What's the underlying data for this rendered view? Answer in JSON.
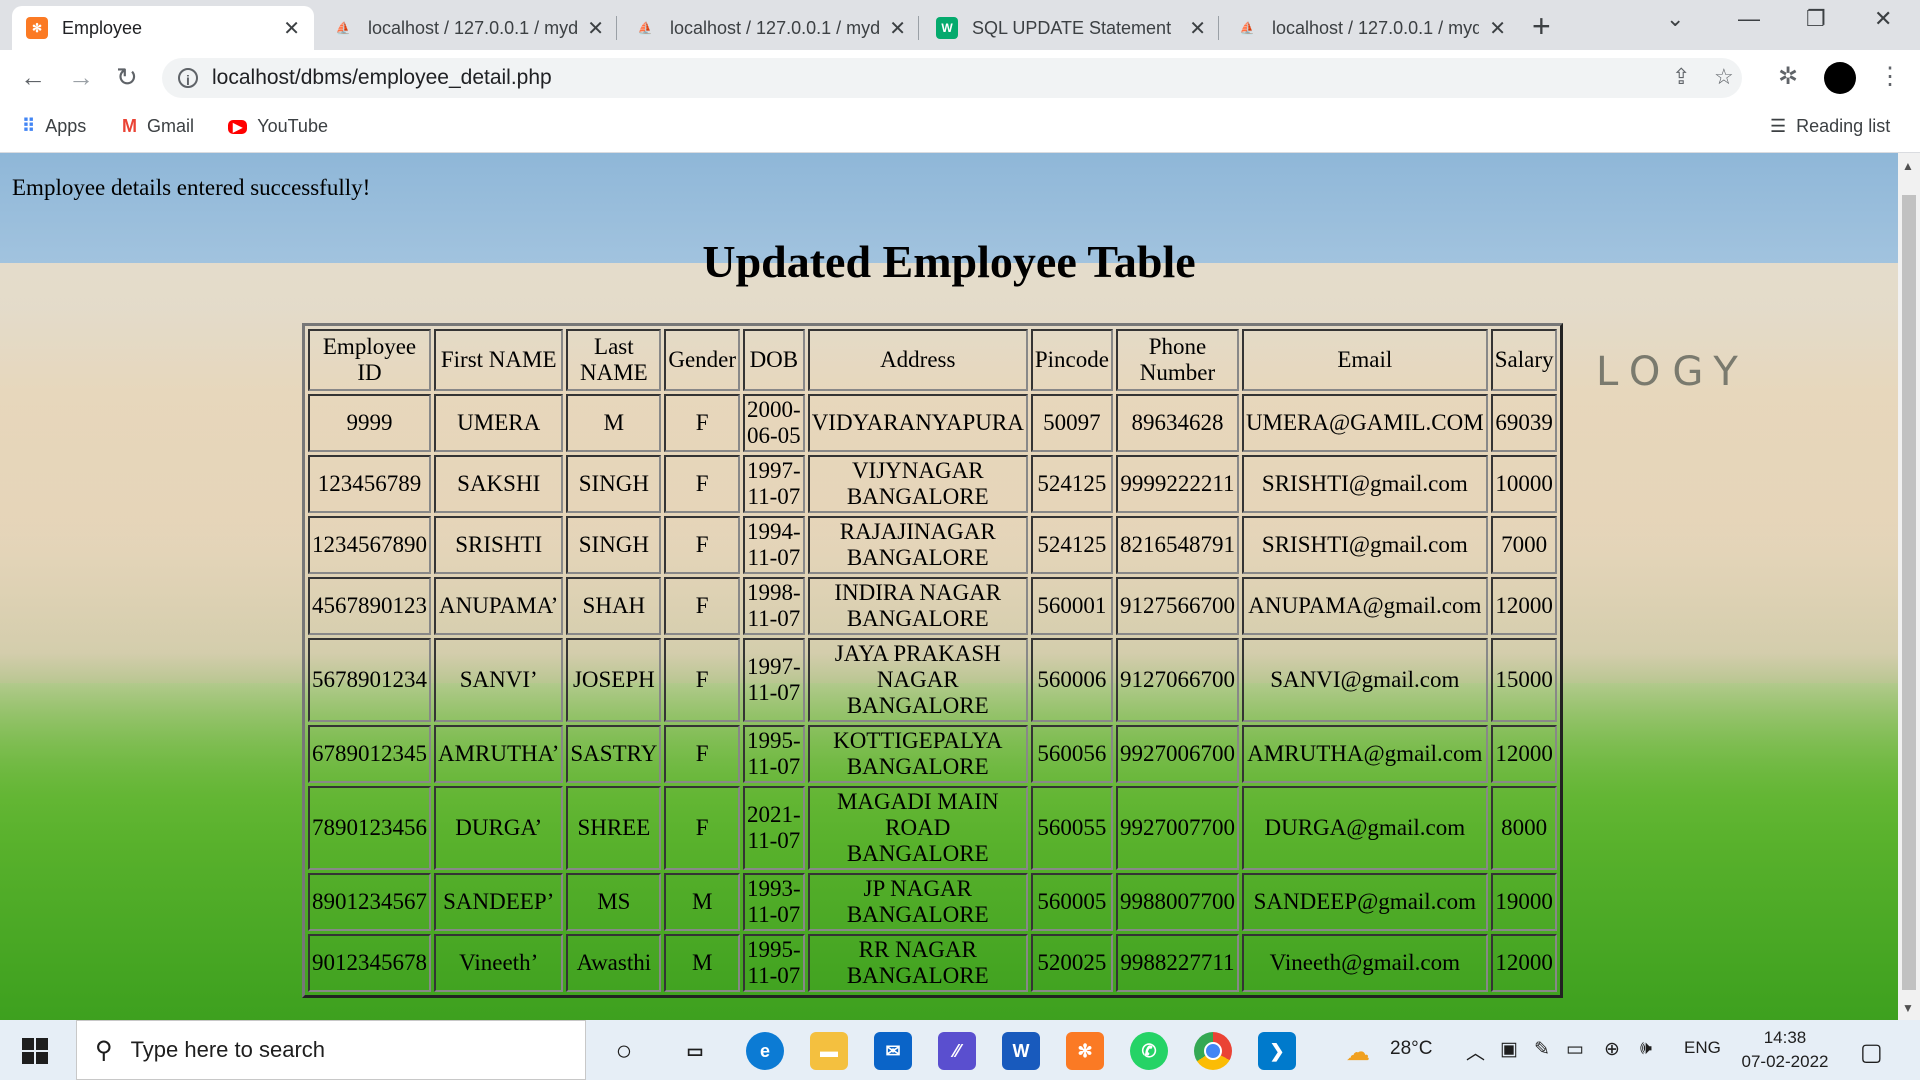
{
  "browser": {
    "tabs": [
      {
        "title": "Employee",
        "icon": "xampp-icon",
        "active": true
      },
      {
        "title": "localhost / 127.0.0.1 / myd",
        "icon": "phpmyadmin-icon",
        "active": false
      },
      {
        "title": "localhost / 127.0.0.1 / myd",
        "icon": "phpmyadmin-icon",
        "active": false
      },
      {
        "title": "SQL UPDATE Statement",
        "icon": "w3schools-icon",
        "active": false
      },
      {
        "title": "localhost / 127.0.0.1 / myd",
        "icon": "phpmyadmin-icon",
        "active": false
      }
    ],
    "url": "localhost/dbms/employee_detail.php",
    "bookmarks": [
      {
        "label": "Apps",
        "icon": "apps-grid-icon"
      },
      {
        "label": "Gmail",
        "icon": "gmail-icon"
      },
      {
        "label": "YouTube",
        "icon": "youtube-icon"
      }
    ],
    "reading_list": "Reading list"
  },
  "page": {
    "message": "Employee details entered successfully!",
    "heading": "Updated Employee Table",
    "background_word": "LOGY"
  },
  "table": {
    "headers": [
      [
        "Employee",
        "ID"
      ],
      [
        "First NAME"
      ],
      [
        "Last",
        "NAME"
      ],
      [
        "Gender"
      ],
      [
        "DOB"
      ],
      [
        "Address"
      ],
      [
        "Pincode"
      ],
      [
        "Phone",
        "Number"
      ],
      [
        "Email"
      ],
      [
        "Salary"
      ]
    ],
    "rows": [
      [
        "9999",
        "UMERA",
        "M",
        "F",
        [
          "2000-",
          "06-05"
        ],
        [
          "VIDYARANYAPURA"
        ],
        "50097",
        "89634628",
        "UMERA@GAMIL.COM",
        "69039"
      ],
      [
        "123456789",
        "SAKSHI",
        "SINGH",
        "F",
        [
          "1997-",
          "11-07"
        ],
        [
          "VIJYNAGAR",
          "BANGALORE"
        ],
        "524125",
        "9999222211",
        "SRISHTI@gmail.com",
        "10000"
      ],
      [
        "1234567890",
        "SRISHTI",
        "SINGH",
        "F",
        [
          "1994-",
          "11-07"
        ],
        [
          "RAJAJINAGAR",
          "BANGALORE"
        ],
        "524125",
        "8216548791",
        "SRISHTI@gmail.com",
        "7000"
      ],
      [
        "4567890123",
        "ANUPAMA’",
        "SHAH",
        "F",
        [
          "1998-",
          "11-07"
        ],
        [
          "INDIRA NAGAR",
          "BANGALORE"
        ],
        "560001",
        "9127566700",
        "ANUPAMA@gmail.com",
        "12000"
      ],
      [
        "5678901234",
        "SANVI’",
        "JOSEPH",
        "F",
        [
          "1997-",
          "11-07"
        ],
        [
          "JAYA PRAKASH",
          "NAGAR",
          "BANGALORE"
        ],
        "560006",
        "9127066700",
        "SANVI@gmail.com",
        "15000"
      ],
      [
        "6789012345",
        "AMRUTHA’",
        "SASTRY",
        "F",
        [
          "1995-",
          "11-07"
        ],
        [
          "KOTTIGEPALYA",
          "BANGALORE"
        ],
        "560056",
        "9927006700",
        "AMRUTHA@gmail.com",
        "12000"
      ],
      [
        "7890123456",
        "DURGA’",
        "SHREE",
        "F",
        [
          "2021-",
          "11-07"
        ],
        [
          "MAGADI MAIN",
          "ROAD",
          "BANGALORE"
        ],
        "560055",
        "9927007700",
        "DURGA@gmail.com",
        "8000"
      ],
      [
        "8901234567",
        "SANDEEP’",
        "MS",
        "M",
        [
          "1993-",
          "11-07"
        ],
        [
          "JP NAGAR",
          "BANGALORE"
        ],
        "560005",
        "9988007700",
        "SANDEEP@gmail.com",
        "19000"
      ],
      [
        "9012345678",
        "Vineeth’",
        "Awasthi",
        "M",
        [
          "1995-",
          "11-07"
        ],
        [
          "RR NAGAR",
          "BANGALORE"
        ],
        "520025",
        "9988227711",
        "Vineeth@gmail.com",
        "12000"
      ]
    ]
  },
  "taskbar": {
    "search_placeholder": "Type here to search",
    "weather": "28°C",
    "language": "ENG",
    "time": "14:38",
    "date": "07-02-2022",
    "apps": [
      "cortana-icon",
      "task-view-icon",
      "edge-icon",
      "file-explorer-icon",
      "mail-icon",
      "visual-studio-icon",
      "word-icon",
      "xampp-icon",
      "whatsapp-icon",
      "chrome-icon",
      "vscode-icon"
    ]
  },
  "colors": {
    "tab_strip": "#dfe1e5",
    "xampp": "#fb7a24",
    "taskbar": "#e6eef6"
  }
}
